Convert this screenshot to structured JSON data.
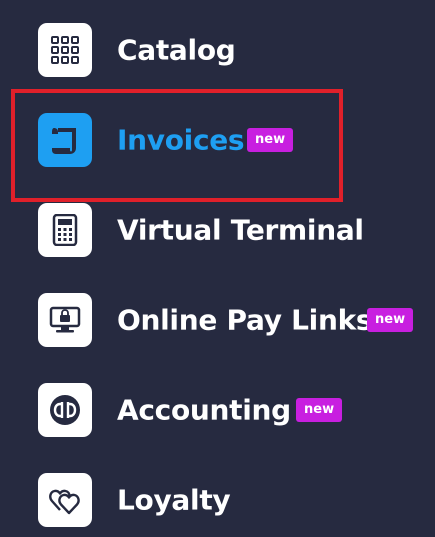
{
  "menu": {
    "items": [
      {
        "label": "Catalog",
        "icon": "grid-icon",
        "badge": ""
      },
      {
        "label": "Invoices",
        "icon": "invoice-scroll-icon",
        "badge": "new",
        "active": true
      },
      {
        "label": "Virtual Terminal",
        "icon": "calculator-icon",
        "badge": ""
      },
      {
        "label": "Online Pay Links",
        "icon": "monitor-lock-icon",
        "badge": "new"
      },
      {
        "label": "Accounting",
        "icon": "quickbooks-icon",
        "badge": "new"
      },
      {
        "label": "Loyalty",
        "icon": "hearts-icon",
        "badge": ""
      }
    ]
  },
  "colors": {
    "background": "#262a40",
    "accent": "#1e9ff2",
    "badge": "#c81fe0",
    "highlight": "#e0202a"
  }
}
